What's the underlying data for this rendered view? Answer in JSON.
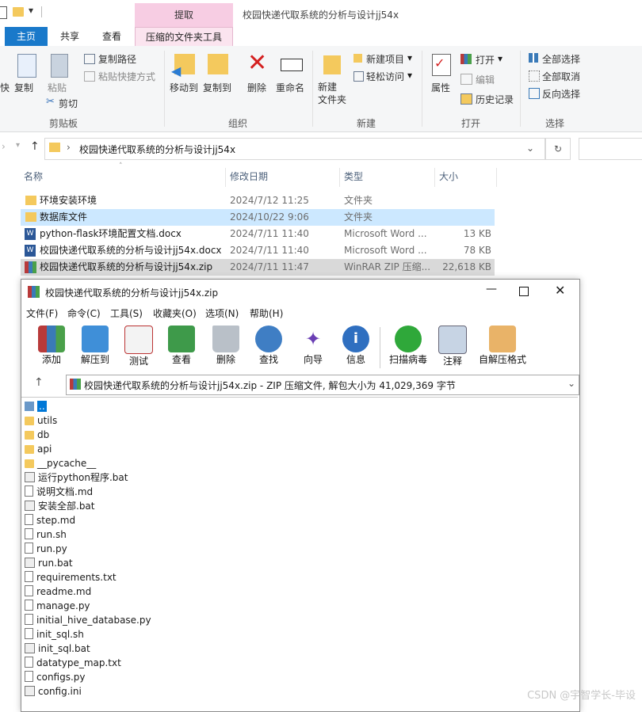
{
  "explorer": {
    "window_title": "校园快递代取系统的分析与设计jj54x",
    "context_tab": "提取",
    "tabs": [
      "主页",
      "共享",
      "查看",
      "压缩的文件夹工具"
    ],
    "ribbon": {
      "cut_partial": "快",
      "copy": "复制",
      "paste": "粘贴",
      "copy_path": "复制路径",
      "paste_shortcut": "粘贴快捷方式",
      "scissors": "剪切",
      "move_to": "移动到",
      "copy_to": "复制到",
      "delete": "删除",
      "rename": "重命名",
      "new_folder": "新建\n文件夹",
      "new_item": "新建项目",
      "easy_access": "轻松访问",
      "properties": "属性",
      "open": "打开",
      "edit": "编辑",
      "history": "历史记录",
      "select_all": "全部选择",
      "select_none": "全部取消",
      "invert_select": "反向选择",
      "groups": [
        "剪贴板",
        "组织",
        "新建",
        "打开",
        "选择"
      ]
    },
    "address": "校园快递代取系统的分析与设计jj54x",
    "columns": [
      "名称",
      "修改日期",
      "类型",
      "大小"
    ],
    "files": [
      {
        "name": "环境安装环境",
        "date": "2024/7/12 11:25",
        "type": "文件夹",
        "size": "",
        "kind": "folder"
      },
      {
        "name": "数据库文件",
        "date": "2024/10/22 9:06",
        "type": "文件夹",
        "size": "",
        "kind": "folder"
      },
      {
        "name": "python-flask环境配置文档.docx",
        "date": "2024/7/11 11:40",
        "type": "Microsoft Word ...",
        "size": "13 KB",
        "kind": "word"
      },
      {
        "name": "校园快递代取系统的分析与设计jj54x.docx",
        "date": "2024/7/11 11:40",
        "type": "Microsoft Word ...",
        "size": "78 KB",
        "kind": "word"
      },
      {
        "name": "校园快递代取系统的分析与设计jj54x.zip",
        "date": "2024/7/11 11:47",
        "type": "WinRAR ZIP 压缩...",
        "size": "22,618 KB",
        "kind": "zip"
      }
    ]
  },
  "winrar": {
    "title": "校园快递代取系统的分析与设计jj54x.zip",
    "menu": [
      "文件(F)",
      "命令(C)",
      "工具(S)",
      "收藏夹(O)",
      "选项(N)",
      "帮助(H)"
    ],
    "toolbar": [
      "添加",
      "解压到",
      "测试",
      "查看",
      "删除",
      "查找",
      "向导",
      "信息",
      "扫描病毒",
      "注释",
      "自解压格式"
    ],
    "address": "校园快递代取系统的分析与设计jj54x.zip - ZIP 压缩文件, 解包大小为 41,029,369 字节",
    "items": [
      {
        "name": "..",
        "kind": "up"
      },
      {
        "name": "utils",
        "kind": "folder"
      },
      {
        "name": "db",
        "kind": "folder"
      },
      {
        "name": "api",
        "kind": "folder"
      },
      {
        "name": "__pycache__",
        "kind": "folder"
      },
      {
        "name": "运行python程序.bat",
        "kind": "bat"
      },
      {
        "name": "说明文档.md",
        "kind": "file"
      },
      {
        "name": "安装全部.bat",
        "kind": "bat"
      },
      {
        "name": "step.md",
        "kind": "file"
      },
      {
        "name": "run.sh",
        "kind": "file"
      },
      {
        "name": "run.py",
        "kind": "file"
      },
      {
        "name": "run.bat",
        "kind": "bat"
      },
      {
        "name": "requirements.txt",
        "kind": "file"
      },
      {
        "name": "readme.md",
        "kind": "file"
      },
      {
        "name": "manage.py",
        "kind": "file"
      },
      {
        "name": "initial_hive_database.py",
        "kind": "file"
      },
      {
        "name": "init_sql.sh",
        "kind": "file"
      },
      {
        "name": "init_sql.bat",
        "kind": "bat"
      },
      {
        "name": "datatype_map.txt",
        "kind": "file"
      },
      {
        "name": "configs.py",
        "kind": "file"
      },
      {
        "name": "config.ini",
        "kind": "bat"
      }
    ]
  },
  "watermark": "CSDN @宇智学长-毕设"
}
